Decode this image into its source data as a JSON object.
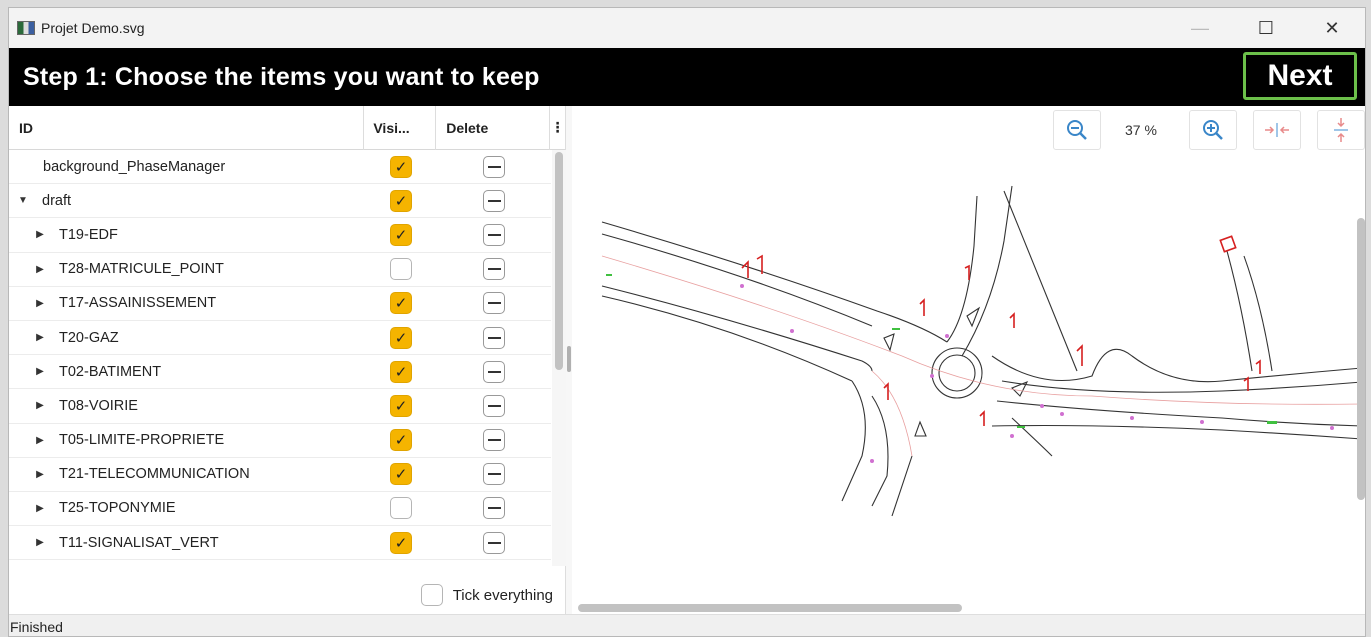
{
  "window": {
    "title": "Projet Demo.svg",
    "controls": {
      "minimize": "—",
      "maximize": "☐",
      "close": "✕"
    }
  },
  "header": {
    "title": "Step 1: Choose the items you want to keep",
    "next_label": "Next",
    "accent_color": "#6cc04a"
  },
  "table": {
    "columns": {
      "id": "ID",
      "visible": "Visi...",
      "delete": "Delete",
      "menu": "⋮"
    },
    "rows": [
      {
        "label": "background_PhaseManager",
        "visible": true,
        "level": 0,
        "expander": "none"
      },
      {
        "label": "draft",
        "visible": true,
        "level": 0,
        "expander": "expanded"
      },
      {
        "label": "T19-EDF",
        "visible": true,
        "level": 1,
        "expander": "collapsed"
      },
      {
        "label": "T28-MATRICULE_POINT",
        "visible": false,
        "level": 1,
        "expander": "collapsed"
      },
      {
        "label": "T17-ASSAINISSEMENT",
        "visible": true,
        "level": 1,
        "expander": "collapsed"
      },
      {
        "label": "T20-GAZ",
        "visible": true,
        "level": 1,
        "expander": "collapsed"
      },
      {
        "label": "T02-BATIMENT",
        "visible": true,
        "level": 1,
        "expander": "collapsed"
      },
      {
        "label": "T08-VOIRIE",
        "visible": true,
        "level": 1,
        "expander": "collapsed"
      },
      {
        "label": "T05-LIMITE-PROPRIETE",
        "visible": true,
        "level": 1,
        "expander": "collapsed"
      },
      {
        "label": "T21-TELECOMMUNICATION",
        "visible": true,
        "level": 1,
        "expander": "collapsed"
      },
      {
        "label": "T25-TOPONYMIE",
        "visible": false,
        "level": 1,
        "expander": "collapsed"
      },
      {
        "label": "T11-SIGNALISAT_VERT",
        "visible": true,
        "level": 1,
        "expander": "collapsed"
      },
      {
        "label": "",
        "visible": true,
        "level": 1,
        "expander": "none"
      }
    ],
    "checked_color": "#f5b400"
  },
  "footer": {
    "tick_everything_label": "Tick everything"
  },
  "viewer": {
    "zoom_level": "37 %",
    "icons": [
      "zoom-out-icon",
      "zoom-in-icon",
      "fit-width-icon",
      "fit-height-icon"
    ]
  },
  "status": {
    "text": "Finished"
  }
}
